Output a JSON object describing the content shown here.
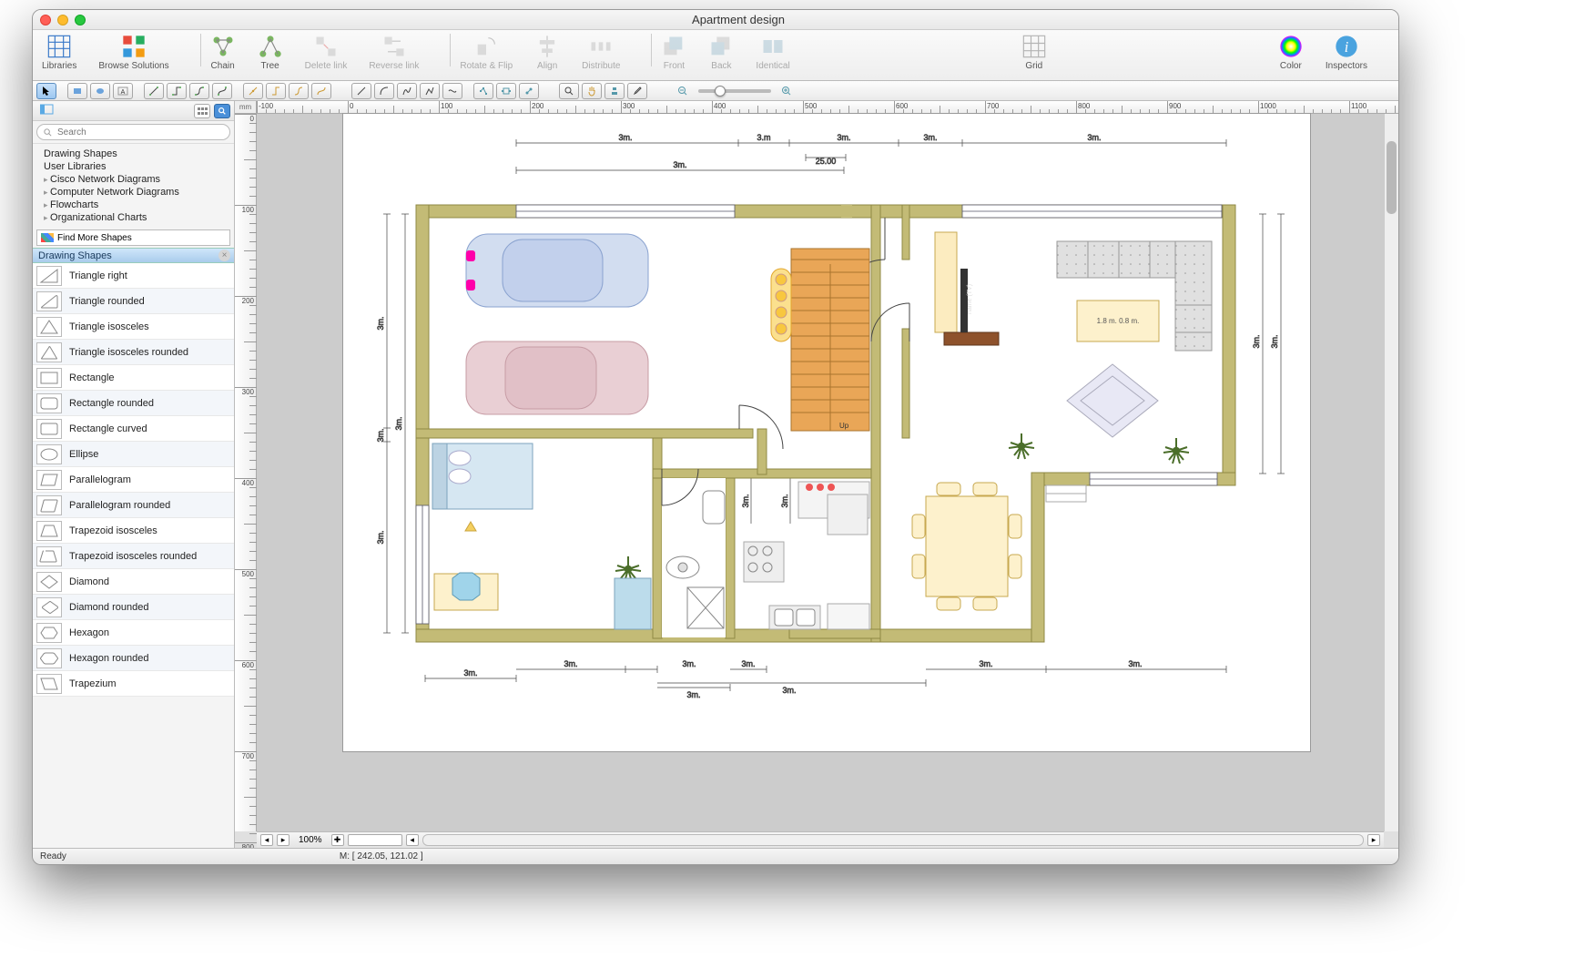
{
  "title": "Apartment design",
  "toolbar": {
    "libraries": "Libraries",
    "browse": "Browse Solutions",
    "chain": "Chain",
    "tree": "Tree",
    "delete_link": "Delete link",
    "reverse_link": "Reverse link",
    "rotate_flip": "Rotate & Flip",
    "align": "Align",
    "distribute": "Distribute",
    "front": "Front",
    "back": "Back",
    "identical": "Identical",
    "grid": "Grid",
    "color": "Color",
    "inspectors": "Inspectors"
  },
  "search_placeholder": "Search",
  "tree": {
    "items": [
      "Drawing Shapes",
      "User Libraries",
      "Cisco Network Diagrams",
      "Computer Network Diagrams",
      "Flowcharts",
      "Organizational Charts"
    ]
  },
  "find_more": "Find More Shapes",
  "section_header": "Drawing Shapes",
  "shapes": [
    "Triangle right",
    "Triangle rounded",
    "Triangle isosceles",
    "Triangle isosceles rounded",
    "Rectangle",
    "Rectangle rounded",
    "Rectangle curved",
    "Ellipse",
    "Parallelogram",
    "Parallelogram rounded",
    "Trapezoid isosceles",
    "Trapezoid isosceles rounded",
    "Diamond",
    "Diamond rounded",
    "Hexagon",
    "Hexagon rounded",
    "Trapezium"
  ],
  "ruler_unit": "mm",
  "zoom_pct": "100%",
  "status_ready": "Ready",
  "status_coord": "M: [ 242.05, 121.02 ]",
  "floorplan": {
    "coffee_table_label": "1.8 m. 0.8 m.",
    "tv_label": "name (TV)",
    "stair_label": "Up",
    "door_dim": "25.00",
    "dims_3m": "3m.",
    "dim_top_3m": "3.m"
  }
}
